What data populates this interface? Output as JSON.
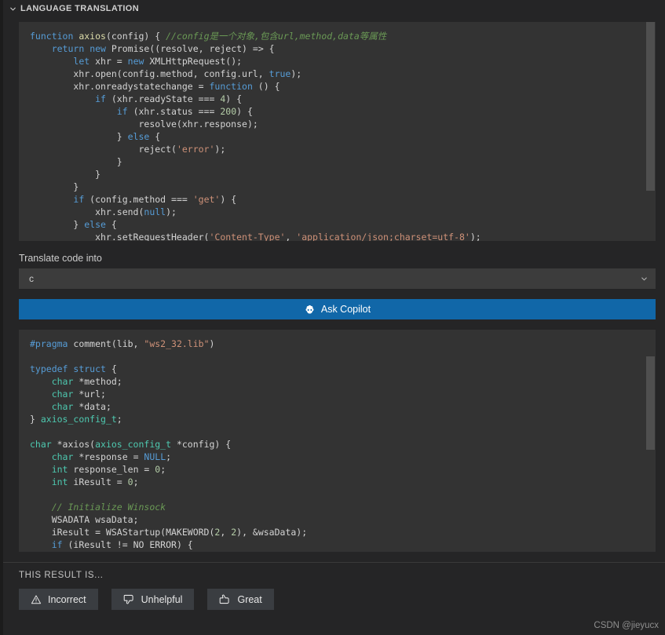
{
  "panel": {
    "title": "LANGUAGE TRANSLATION",
    "collapse_icon": "chevron-down-icon"
  },
  "input_code": {
    "language": "javascript",
    "lines": [
      [
        {
          "t": "function",
          "c": "kw"
        },
        {
          "t": " ",
          "c": "pl"
        },
        {
          "t": "axios",
          "c": "fn"
        },
        {
          "t": "(config) { ",
          "c": "pl"
        },
        {
          "t": "//config是一个对象,包含url,method,data等属性",
          "c": "cmt"
        }
      ],
      [
        {
          "t": "    ",
          "c": "pl"
        },
        {
          "t": "return",
          "c": "kw"
        },
        {
          "t": " ",
          "c": "pl"
        },
        {
          "t": "new",
          "c": "kw"
        },
        {
          "t": " Promise((resolve, reject) => {",
          "c": "pl"
        }
      ],
      [
        {
          "t": "        ",
          "c": "pl"
        },
        {
          "t": "let",
          "c": "kw"
        },
        {
          "t": " xhr = ",
          "c": "pl"
        },
        {
          "t": "new",
          "c": "kw"
        },
        {
          "t": " XMLHttpRequest();",
          "c": "pl"
        }
      ],
      [
        {
          "t": "        xhr.open(config.method, config.url, ",
          "c": "pl"
        },
        {
          "t": "true",
          "c": "kw"
        },
        {
          "t": ");",
          "c": "pl"
        }
      ],
      [
        {
          "t": "        xhr.onreadystatechange = ",
          "c": "pl"
        },
        {
          "t": "function",
          "c": "kw"
        },
        {
          "t": " () {",
          "c": "pl"
        }
      ],
      [
        {
          "t": "            ",
          "c": "pl"
        },
        {
          "t": "if",
          "c": "kw"
        },
        {
          "t": " (xhr.readyState === ",
          "c": "pl"
        },
        {
          "t": "4",
          "c": "num"
        },
        {
          "t": ") {",
          "c": "pl"
        }
      ],
      [
        {
          "t": "                ",
          "c": "pl"
        },
        {
          "t": "if",
          "c": "kw"
        },
        {
          "t": " (xhr.status === ",
          "c": "pl"
        },
        {
          "t": "200",
          "c": "num"
        },
        {
          "t": ") {",
          "c": "pl"
        }
      ],
      [
        {
          "t": "                    resolve(xhr.response);",
          "c": "pl"
        }
      ],
      [
        {
          "t": "                } ",
          "c": "pl"
        },
        {
          "t": "else",
          "c": "kw"
        },
        {
          "t": " {",
          "c": "pl"
        }
      ],
      [
        {
          "t": "                    reject(",
          "c": "pl"
        },
        {
          "t": "'error'",
          "c": "str"
        },
        {
          "t": ");",
          "c": "pl"
        }
      ],
      [
        {
          "t": "                }",
          "c": "pl"
        }
      ],
      [
        {
          "t": "            }",
          "c": "pl"
        }
      ],
      [
        {
          "t": "        }",
          "c": "pl"
        }
      ],
      [
        {
          "t": "        ",
          "c": "pl"
        },
        {
          "t": "if",
          "c": "kw"
        },
        {
          "t": " (config.method === ",
          "c": "pl"
        },
        {
          "t": "'get'",
          "c": "str"
        },
        {
          "t": ") {",
          "c": "pl"
        }
      ],
      [
        {
          "t": "            xhr.send(",
          "c": "pl"
        },
        {
          "t": "null",
          "c": "kw"
        },
        {
          "t": ");",
          "c": "pl"
        }
      ],
      [
        {
          "t": "        } ",
          "c": "pl"
        },
        {
          "t": "else",
          "c": "kw"
        },
        {
          "t": " {",
          "c": "pl"
        }
      ],
      [
        {
          "t": "            xhr.setRequestHeader(",
          "c": "pl"
        },
        {
          "t": "'Content-Type'",
          "c": "str"
        },
        {
          "t": ", ",
          "c": "pl"
        },
        {
          "t": "'application/json;charset=utf-8'",
          "c": "str"
        },
        {
          "t": ");",
          "c": "pl"
        }
      ]
    ],
    "scrollbar": {
      "thumb_top_pct": 0,
      "thumb_height_pct": 77
    }
  },
  "translate_field": {
    "label": "Translate code into",
    "value": "c",
    "arrow_icon": "chevron-down-icon"
  },
  "ask_button": {
    "label": "Ask Copilot",
    "icon": "copilot-icon",
    "color": "#1167a8"
  },
  "output_code": {
    "language": "c",
    "lines": [
      [
        {
          "t": "#pragma",
          "c": "kw"
        },
        {
          "t": " comment(lib, ",
          "c": "pl"
        },
        {
          "t": "\"ws2_32.lib\"",
          "c": "str"
        },
        {
          "t": ")",
          "c": "pl"
        }
      ],
      [
        {
          "t": "",
          "c": "pl"
        }
      ],
      [
        {
          "t": "typedef",
          "c": "kw"
        },
        {
          "t": " ",
          "c": "pl"
        },
        {
          "t": "struct",
          "c": "kw"
        },
        {
          "t": " {",
          "c": "pl"
        }
      ],
      [
        {
          "t": "    ",
          "c": "pl"
        },
        {
          "t": "char",
          "c": "kw2"
        },
        {
          "t": " *method;",
          "c": "pl"
        }
      ],
      [
        {
          "t": "    ",
          "c": "pl"
        },
        {
          "t": "char",
          "c": "kw2"
        },
        {
          "t": " *url;",
          "c": "pl"
        }
      ],
      [
        {
          "t": "    ",
          "c": "pl"
        },
        {
          "t": "char",
          "c": "kw2"
        },
        {
          "t": " *data;",
          "c": "pl"
        }
      ],
      [
        {
          "t": "} ",
          "c": "pl"
        },
        {
          "t": "axios_config_t",
          "c": "kw2"
        },
        {
          "t": ";",
          "c": "pl"
        }
      ],
      [
        {
          "t": "",
          "c": "pl"
        }
      ],
      [
        {
          "t": "char",
          "c": "kw2"
        },
        {
          "t": " *axios(",
          "c": "pl"
        },
        {
          "t": "axios_config_t",
          "c": "kw2"
        },
        {
          "t": " *config) {",
          "c": "pl"
        }
      ],
      [
        {
          "t": "    ",
          "c": "pl"
        },
        {
          "t": "char",
          "c": "kw2"
        },
        {
          "t": " *response = ",
          "c": "pl"
        },
        {
          "t": "NULL",
          "c": "kw"
        },
        {
          "t": ";",
          "c": "pl"
        }
      ],
      [
        {
          "t": "    ",
          "c": "pl"
        },
        {
          "t": "int",
          "c": "kw2"
        },
        {
          "t": " response_len = ",
          "c": "pl"
        },
        {
          "t": "0",
          "c": "num"
        },
        {
          "t": ";",
          "c": "pl"
        }
      ],
      [
        {
          "t": "    ",
          "c": "pl"
        },
        {
          "t": "int",
          "c": "kw2"
        },
        {
          "t": " iResult = ",
          "c": "pl"
        },
        {
          "t": "0",
          "c": "num"
        },
        {
          "t": ";",
          "c": "pl"
        }
      ],
      [
        {
          "t": "",
          "c": "pl"
        }
      ],
      [
        {
          "t": "    ",
          "c": "pl"
        },
        {
          "t": "// Initialize Winsock",
          "c": "cmt"
        }
      ],
      [
        {
          "t": "    WSADATA wsaData;",
          "c": "pl"
        }
      ],
      [
        {
          "t": "    iResult = WSAStartup(MAKEWORD(",
          "c": "pl"
        },
        {
          "t": "2",
          "c": "num"
        },
        {
          "t": ", ",
          "c": "pl"
        },
        {
          "t": "2",
          "c": "num"
        },
        {
          "t": "), &wsaData);",
          "c": "pl"
        }
      ],
      [
        {
          "t": "    ",
          "c": "pl"
        },
        {
          "t": "if",
          "c": "kw"
        },
        {
          "t": " (iResult != NO ERROR) {",
          "c": "pl"
        }
      ]
    ],
    "scrollbar": {
      "thumb_top_pct": 12,
      "thumb_height_pct": 42
    }
  },
  "feedback": {
    "title": "THIS RESULT IS...",
    "buttons": [
      {
        "label": "Incorrect",
        "icon": "warning-triangle-icon"
      },
      {
        "label": "Unhelpful",
        "icon": "thumbs-down-icon"
      },
      {
        "label": "Great",
        "icon": "thumbs-up-icon"
      }
    ]
  },
  "watermark": "CSDN @jieyucx"
}
